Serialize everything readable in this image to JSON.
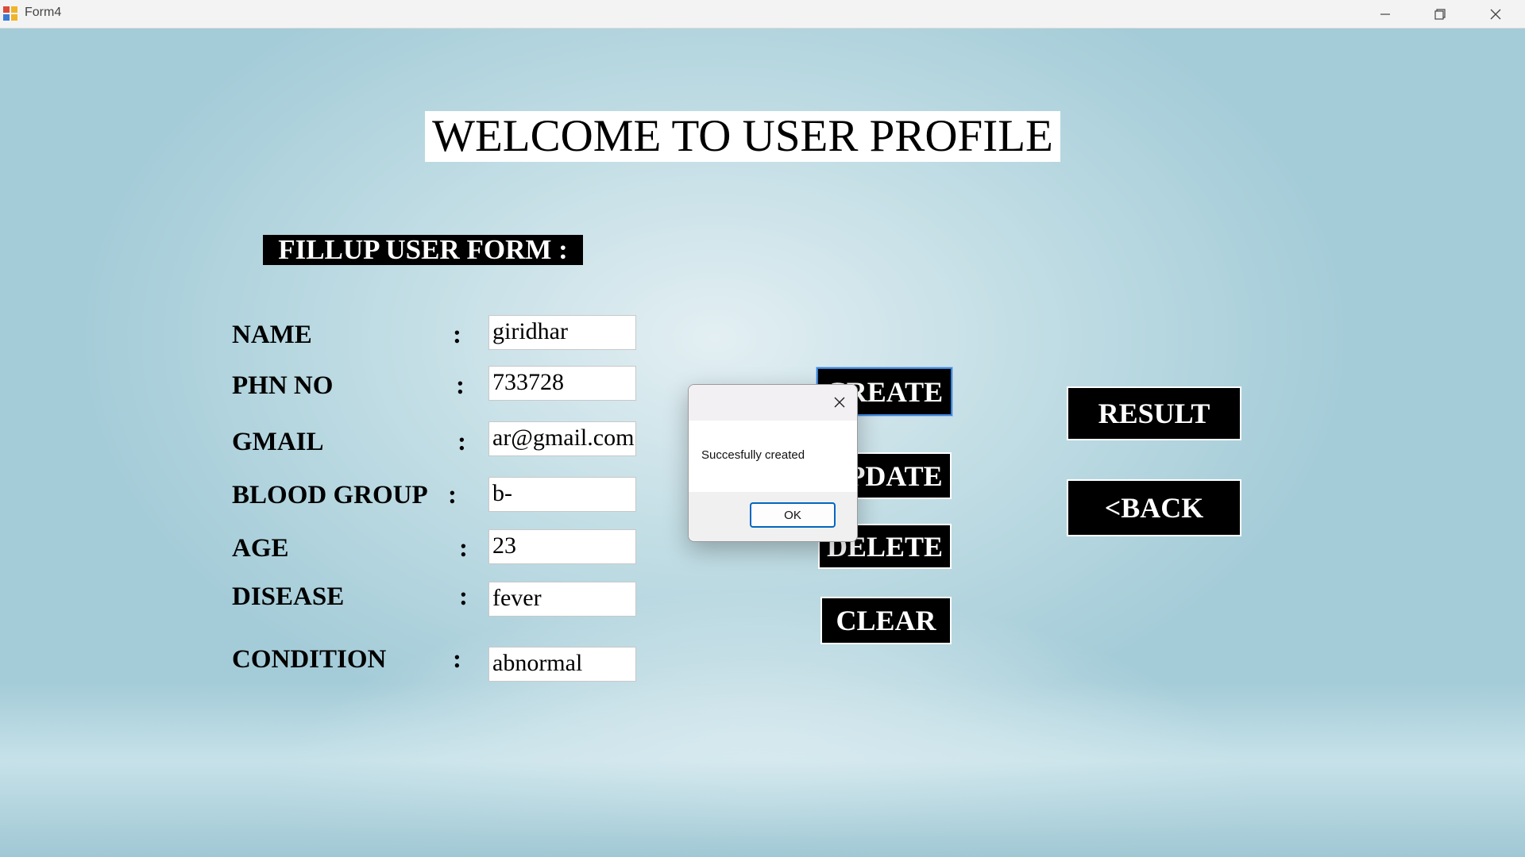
{
  "window": {
    "title": "Form4",
    "controls": [
      "minimize-icon",
      "restore-icon",
      "close-icon"
    ]
  },
  "heading": "WELCOME TO USER PROFILE",
  "subheading": "FILLUP USER FORM  :",
  "form": {
    "separator": ":",
    "fields": [
      {
        "label": "NAME",
        "value": "giridhar"
      },
      {
        "label": "PHN NO",
        "value": "733728"
      },
      {
        "label": "GMAIL",
        "value": "ar@gmail.com"
      },
      {
        "label": "BLOOD GROUP",
        "value": "b-"
      },
      {
        "label": "AGE",
        "value": "23"
      },
      {
        "label": "DISEASE",
        "value": "fever"
      },
      {
        "label": "CONDITION",
        "value": "abnormal"
      }
    ]
  },
  "buttons": {
    "create": "CREATE",
    "update": "UPDATE",
    "delete": "DELETE",
    "clear": "CLEAR",
    "result": "RESULT",
    "back": "<BACK"
  },
  "dialog": {
    "message": "Succesfully created",
    "ok": "OK"
  },
  "colors": {
    "button_bg": "#000000",
    "button_text": "#ffffff",
    "background": "#a8d0db",
    "focus_border": "#3c86d8",
    "dialog_accent": "#0067c0"
  }
}
